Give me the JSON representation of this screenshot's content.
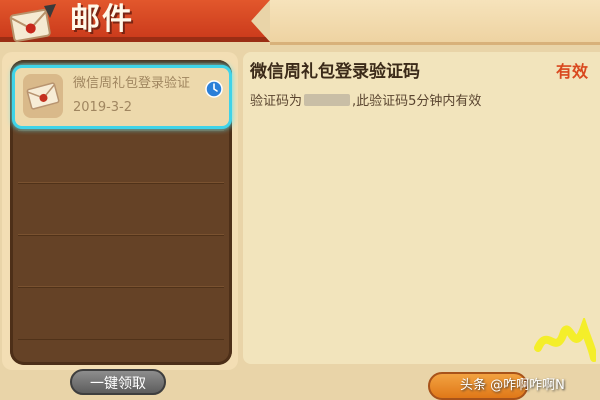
{
  "header": {
    "title": "邮件",
    "icon": "mail-envelope-icon"
  },
  "mail_list": {
    "items": [
      {
        "subject": "微信周礼包登录验证",
        "date": "2019-3-2",
        "icon": "envelope-icon",
        "status_icon": "clock-icon"
      }
    ],
    "claim_all_label": "一键领取"
  },
  "mail_detail": {
    "title": "微信周礼包登录验证码",
    "status": "有效",
    "body_before": "验证码为",
    "body_after": ",此验证码5分钟内有效"
  },
  "watermark": "头条 @咋啊咋啊N",
  "colors": {
    "accent": "#3fd3e8",
    "banner": "#d2431f",
    "list_bg": "#654226",
    "status": "#d9481e"
  }
}
